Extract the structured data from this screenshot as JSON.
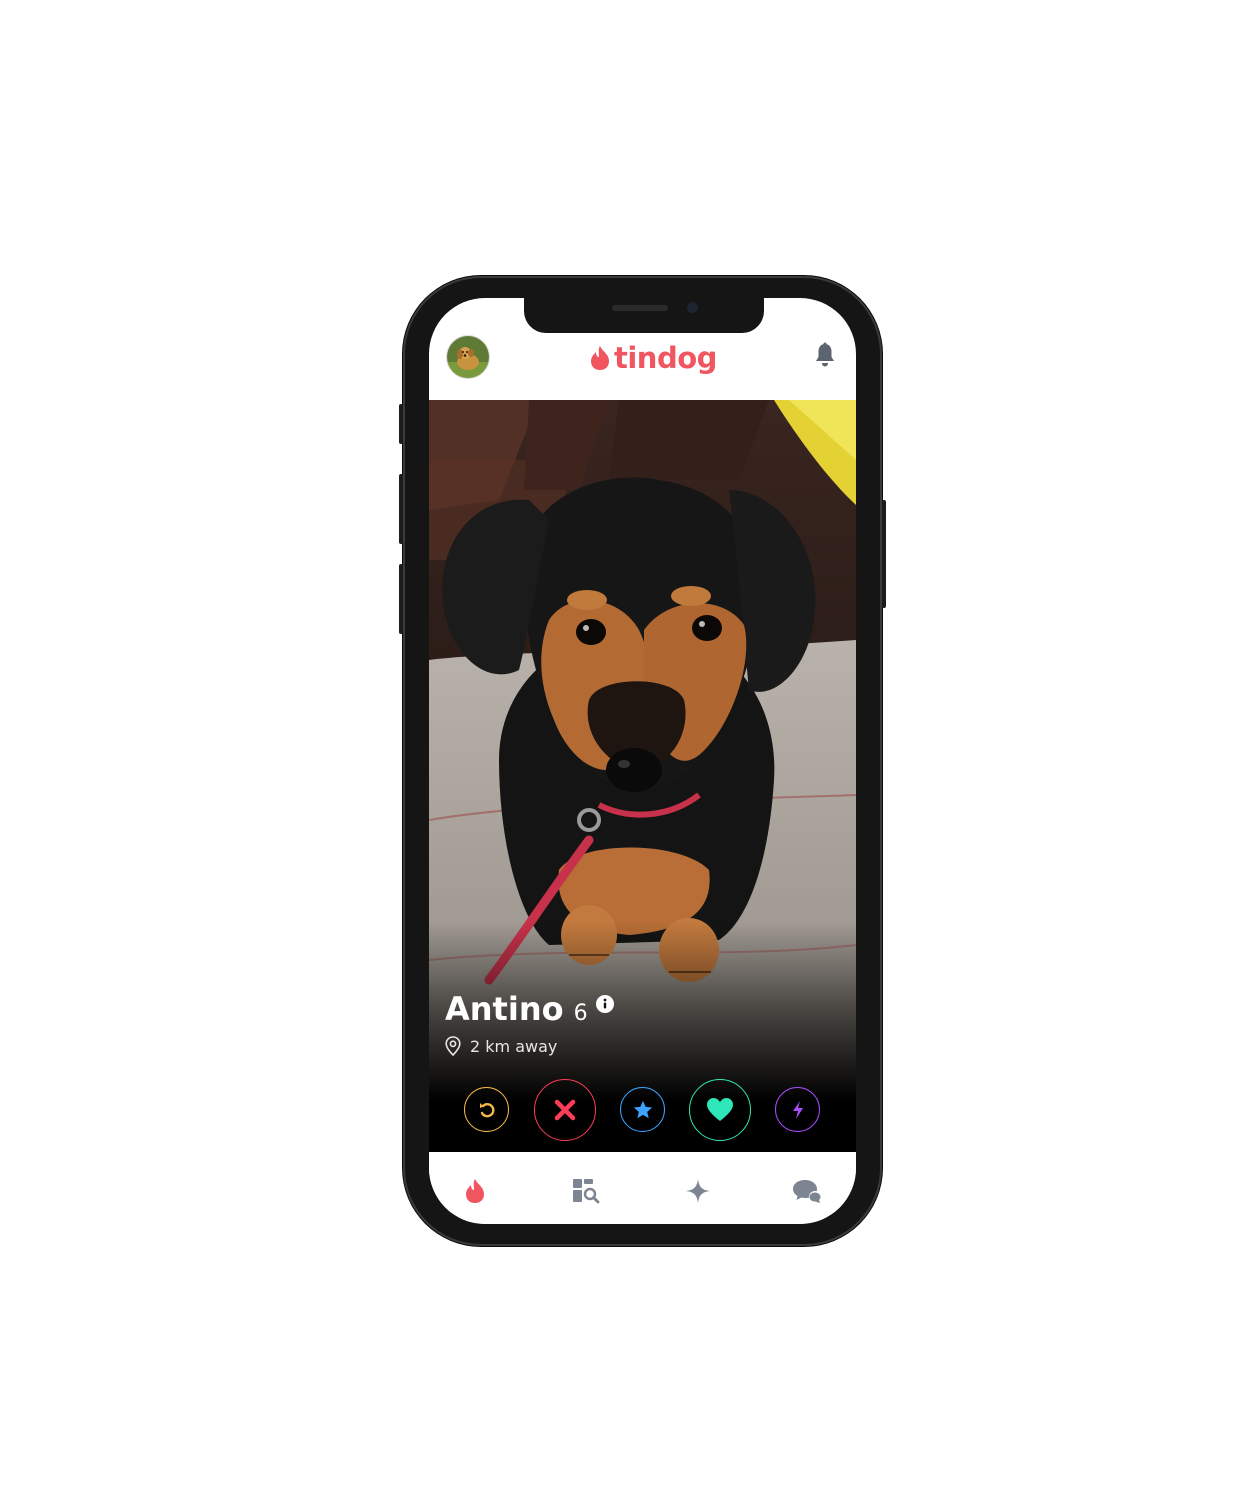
{
  "header": {
    "logo_text": "tindog",
    "avatar_icon": "user-avatar",
    "bell_icon": "bell-icon"
  },
  "profile": {
    "name": "Antino",
    "age": "6",
    "distance": "2 km away"
  },
  "actions": [
    {
      "icon": "rewind-icon",
      "color": "#f5b748"
    },
    {
      "icon": "nope-icon",
      "color": "#fd3c58"
    },
    {
      "icon": "super-like-icon",
      "color": "#3ca4ff"
    },
    {
      "icon": "like-icon",
      "color": "#2ee6b7"
    },
    {
      "icon": "boost-icon",
      "color": "#a94dff"
    }
  ],
  "tabs": [
    {
      "icon": "flame-icon",
      "active": true
    },
    {
      "icon": "explore-icon",
      "active": false
    },
    {
      "icon": "sparkle-icon",
      "active": false
    },
    {
      "icon": "messages-icon",
      "active": false
    }
  ],
  "colors": {
    "brand": "#f05560",
    "inactive_icon": "#7c8591"
  }
}
